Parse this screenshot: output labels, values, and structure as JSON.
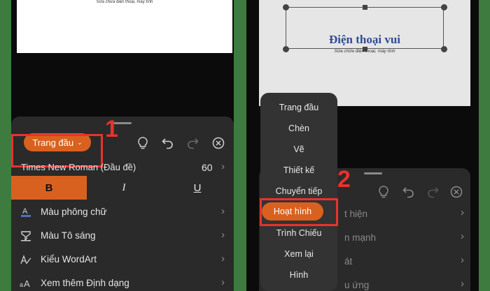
{
  "left": {
    "doc_caption": "Sửa chữa điện thoại, máy tính",
    "tab_label": "Trang đầu",
    "step": "1",
    "font_name": "Times New Roman (Đầu đề)",
    "font_size": "60",
    "format": {
      "bold": "B",
      "italic": "I",
      "underline": "U"
    },
    "menu": [
      {
        "label": "Màu phông chữ",
        "icon": "font-color-icon"
      },
      {
        "label": "Màu Tô sáng",
        "icon": "highlighter-icon"
      },
      {
        "label": "Kiểu WordArt",
        "icon": "wordart-icon"
      },
      {
        "label": "Xem thêm Định dạng",
        "icon": "more-format-icon"
      }
    ]
  },
  "right": {
    "slide_title": "Điện thoại vui",
    "slide_subtitle": "Sửa chữa điện thoại, máy tính",
    "step": "2",
    "menu_items": [
      "Trang đầu",
      "Chèn",
      "Vẽ",
      "Thiết kế",
      "Chuyển tiếp",
      "Hoạt hình",
      "Trình Chiếu",
      "Xem lại",
      "Hình"
    ],
    "active_item": "Hoạt hình",
    "partial_rows": [
      "t hiện",
      "n mạnh",
      "át",
      "u ứng"
    ]
  },
  "colors": {
    "accent": "#d9611f",
    "highlight": "#e8322d",
    "frame": "#3e7b3e"
  }
}
